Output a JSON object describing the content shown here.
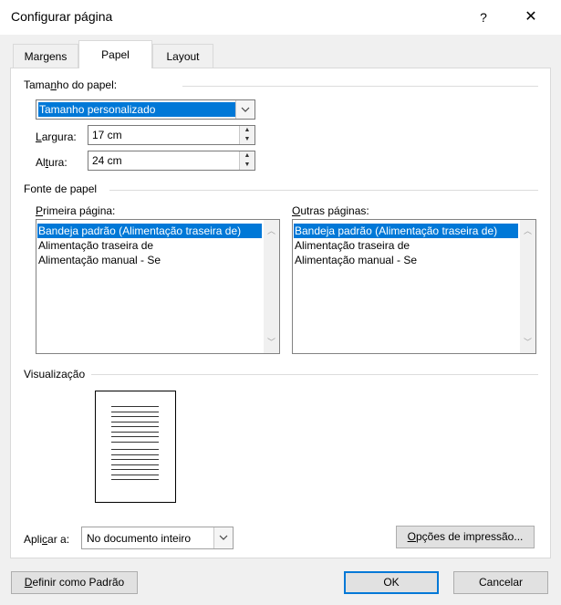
{
  "window": {
    "title": "Configurar página",
    "help": "?",
    "close": "✕"
  },
  "tabs": [
    {
      "label": "Margens",
      "selected": false
    },
    {
      "label": "Papel",
      "selected": true
    },
    {
      "label": "Layout",
      "selected": false
    }
  ],
  "paper_size": {
    "group_label_pre": "Tama",
    "group_label_accel": "n",
    "group_label_post": "ho do papel:",
    "selected": "Tamanho personalizado",
    "width_label_accel": "L",
    "width_label_rest": "argura:",
    "width_value": "17 cm",
    "height_label_pre": "Al",
    "height_label_accel": "t",
    "height_label_post": "ura:",
    "height_value": "24 cm"
  },
  "paper_source": {
    "group_label": "Fonte de papel",
    "first_page_label_accel": "P",
    "first_page_label_rest": "rimeira página:",
    "other_pages_label_accel": "O",
    "other_pages_label_rest": "utras páginas:",
    "first_page_items": [
      "Bandeja padrão (Alimentação traseira de)",
      "Alimentação traseira de",
      "Alimentação manual - Se"
    ],
    "other_pages_items": [
      "Bandeja padrão (Alimentação traseira de)",
      "Alimentação traseira de",
      "Alimentação manual - Se"
    ],
    "selected_index": 0
  },
  "preview": {
    "group_label": "Visualização"
  },
  "apply": {
    "label_pre": "Apli",
    "label_accel": "c",
    "label_post": "ar a:",
    "value": "No documento inteiro"
  },
  "buttons": {
    "print_options_accel": "O",
    "print_options_rest": "pções de impressão...",
    "set_default_accel": "D",
    "set_default_rest": "efinir como Padrão",
    "ok": "OK",
    "cancel": "Cancelar"
  },
  "icons": {
    "dropdown": "chevron-down-icon",
    "spin_up": "caret-up-icon",
    "spin_down": "caret-down-icon",
    "scroll_up": "chevron-up-icon",
    "scroll_down": "chevron-down-icon"
  },
  "colors": {
    "selection": "#0078d7",
    "dialog_bg": "#f0f0f0",
    "panel_bg": "#ffffff"
  }
}
